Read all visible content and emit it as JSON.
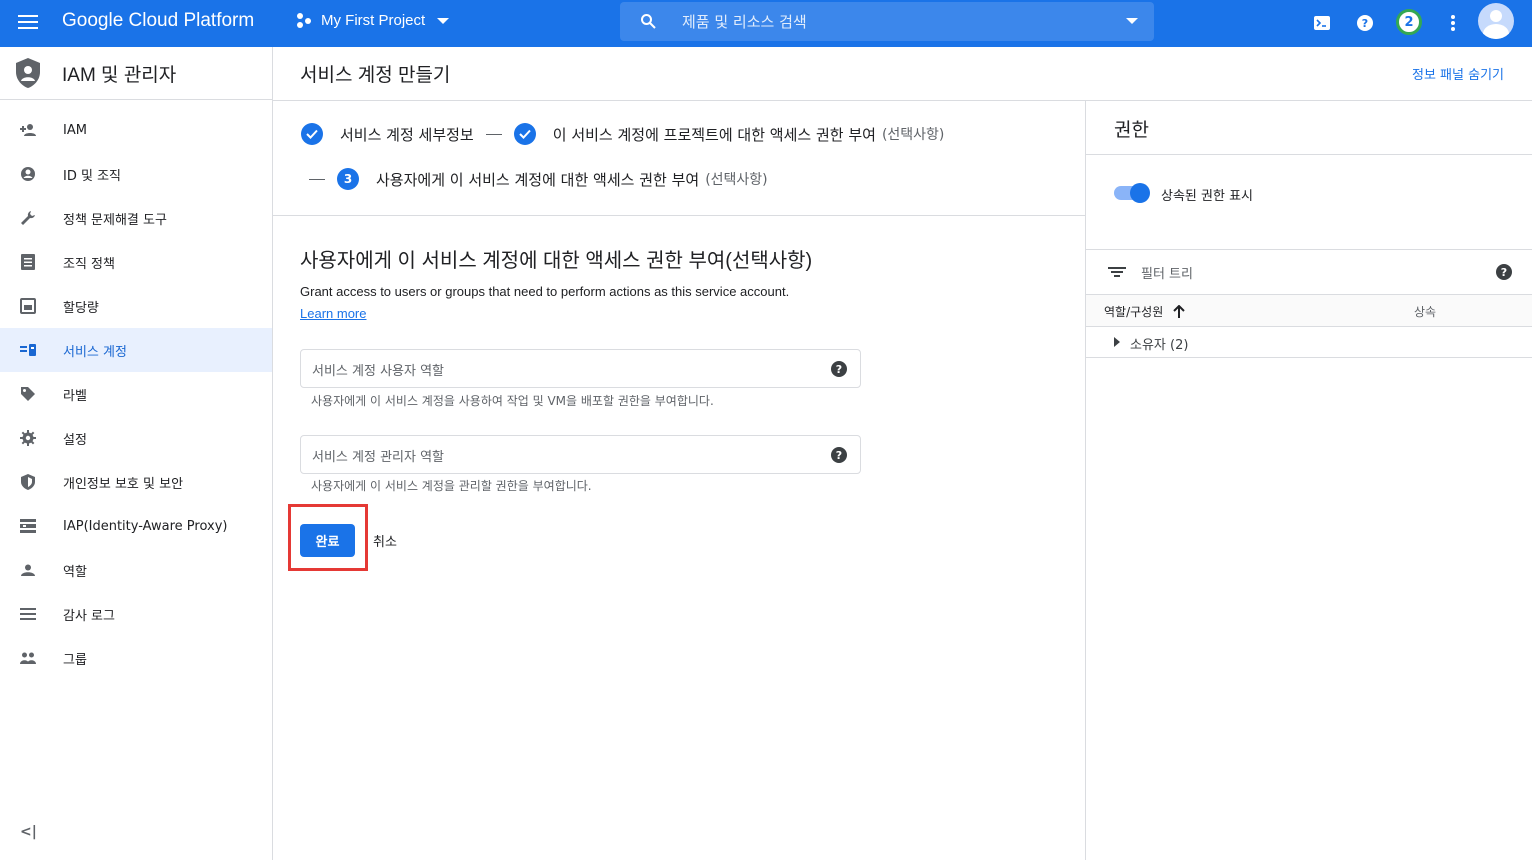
{
  "topbar": {
    "brand": "Google Cloud Platform",
    "project": "My First Project",
    "search_placeholder": "제품 및 리소스 검색",
    "notification_count": "2"
  },
  "sidebar": {
    "title": "IAM 및 관리자",
    "items": [
      {
        "label": "IAM",
        "icon": "person-add-icon"
      },
      {
        "label": "ID 및 조직",
        "icon": "account-circle-icon"
      },
      {
        "label": "정책 문제해결 도구",
        "icon": "wrench-icon"
      },
      {
        "label": "조직 정책",
        "icon": "document-icon"
      },
      {
        "label": "할당량",
        "icon": "quota-icon"
      },
      {
        "label": "서비스 계정",
        "icon": "service-account-icon",
        "active": true
      },
      {
        "label": "라벨",
        "icon": "label-icon"
      },
      {
        "label": "설정",
        "icon": "gear-icon"
      },
      {
        "label": "개인정보 보호 및 보안",
        "icon": "shield-icon"
      },
      {
        "label": "IAP(Identity-Aware Proxy)",
        "icon": "iap-icon"
      },
      {
        "label": "역할",
        "icon": "roles-icon"
      },
      {
        "label": "감사 로그",
        "icon": "list-icon"
      },
      {
        "label": "그룹",
        "icon": "groups-icon"
      }
    ],
    "collapse_label": "<|"
  },
  "header": {
    "page_title": "서비스 계정 만들기",
    "hide_panel": "정보 패널 숨기기"
  },
  "steps": {
    "step1": "서비스 계정 세부정보",
    "step2": "이 서비스 계정에 프로젝트에 대한 액세스 권한 부여",
    "step2_optional": "(선택사항)",
    "step3_num": "3",
    "step3": "사용자에게 이 서비스 계정에 대한 액세스 권한 부여",
    "step3_optional": "(선택사항)"
  },
  "main": {
    "section_title": "사용자에게 이 서비스 계정에 대한 액세스 권한 부여(선택사항)",
    "description": "Grant access to users or groups that need to perform actions as this service account.",
    "learn_more": "Learn more",
    "field1_placeholder": "서비스 계정 사용자 역할",
    "field1_hint": "사용자에게 이 서비스 계정을 사용하여 작업 및 VM을 배포할 권한을 부여합니다.",
    "field2_placeholder": "서비스 계정 관리자 역할",
    "field2_hint": "사용자에게 이 서비스 계정을 관리할 권한을 부여합니다.",
    "done_label": "완료",
    "cancel_label": "취소"
  },
  "panel": {
    "title": "권한",
    "toggle_label": "상속된 권한 표시",
    "filter_placeholder": "필터 트리",
    "col_role": "역할/구성원",
    "col_inherited": "상속",
    "row_owner": "소유자 (2)"
  },
  "colors": {
    "brand_blue": "#1a73e8",
    "highlight_red": "#e53935",
    "active_bg": "#e8f0fe"
  }
}
